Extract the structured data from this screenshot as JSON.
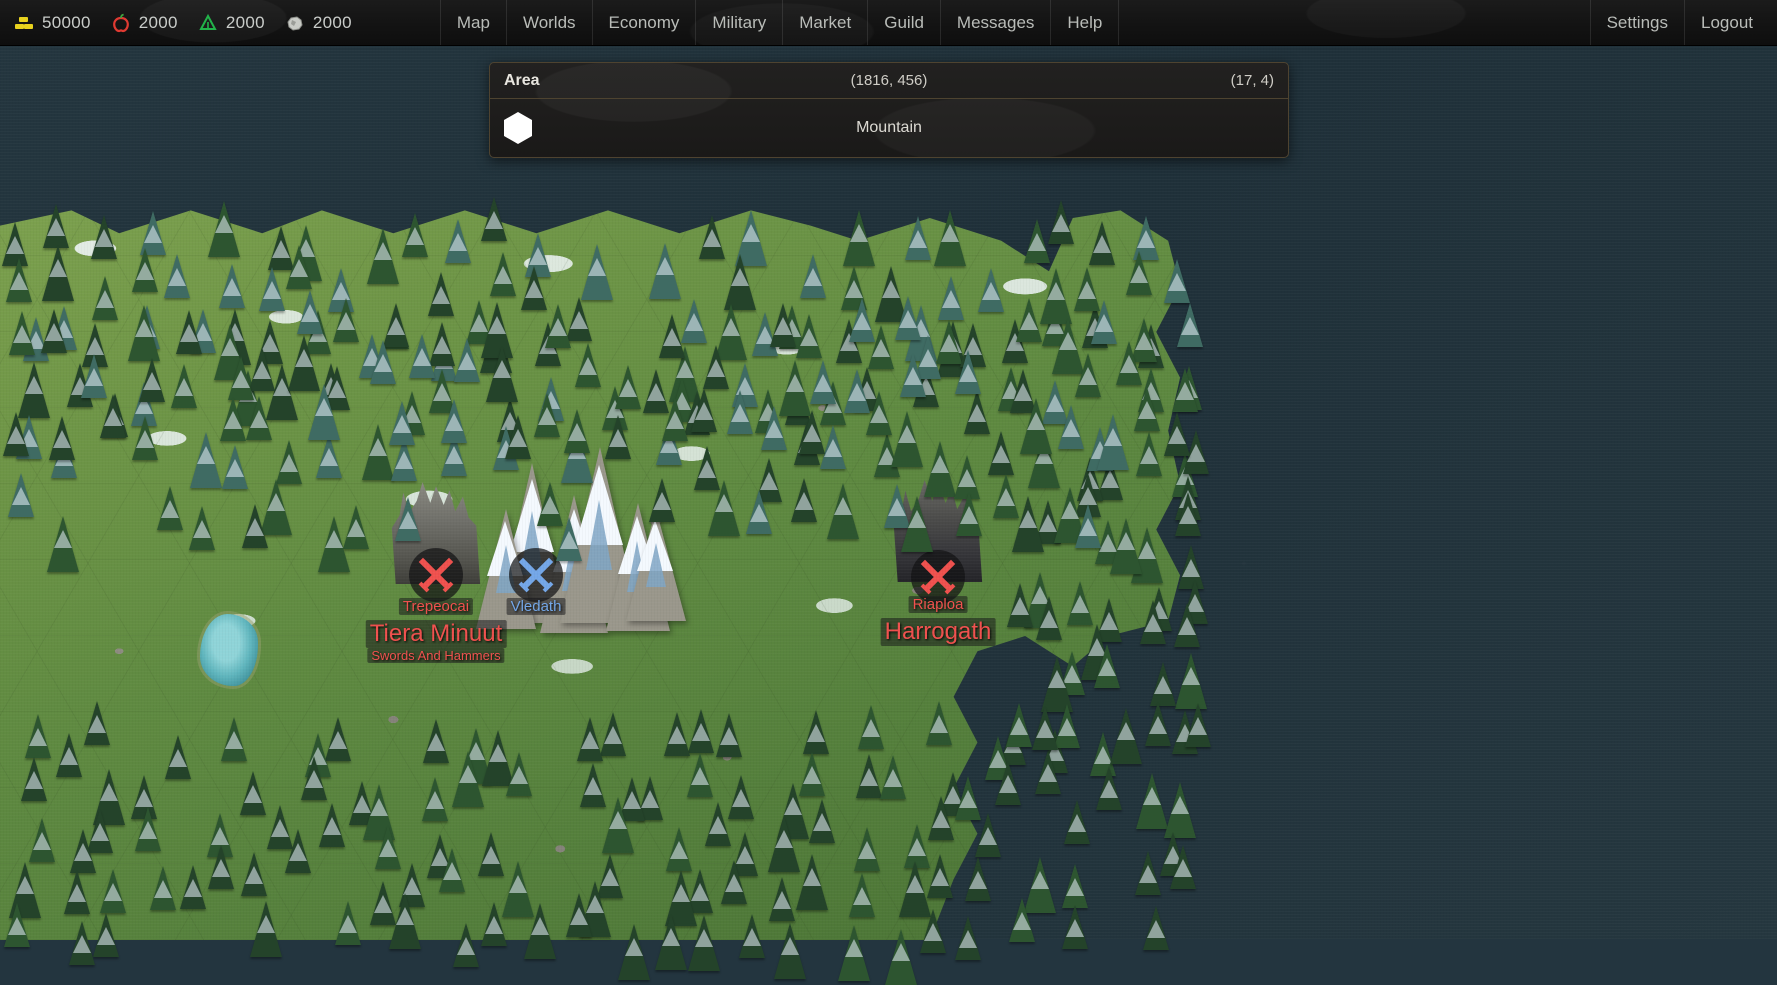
{
  "topbar": {
    "resources": [
      {
        "icon": "gold-bars-icon",
        "name": "gold",
        "value": "50000",
        "color": "#e8d21e"
      },
      {
        "icon": "apple-icon",
        "name": "food",
        "value": "2000",
        "color": "#e03a32"
      },
      {
        "icon": "tree-icon",
        "name": "wood",
        "value": "2000",
        "color": "#22b34a"
      },
      {
        "icon": "stone-icon",
        "name": "stone",
        "value": "2000",
        "color": "#b9bcb8"
      }
    ],
    "nav": [
      {
        "id": "map",
        "label": "Map"
      },
      {
        "id": "worlds",
        "label": "Worlds"
      },
      {
        "id": "economy",
        "label": "Economy"
      },
      {
        "id": "military",
        "label": "Military"
      },
      {
        "id": "market",
        "label": "Market"
      },
      {
        "id": "guild",
        "label": "Guild"
      },
      {
        "id": "messages",
        "label": "Messages"
      },
      {
        "id": "help",
        "label": "Help"
      }
    ],
    "account": [
      {
        "id": "settings",
        "label": "Settings"
      },
      {
        "id": "logout",
        "label": "Logout"
      }
    ]
  },
  "panel": {
    "title": "Area",
    "world_coords": "(1816, 456)",
    "hex_coords": "(17, 4)",
    "terrain_icon": "hexagon-icon",
    "terrain_name": "Mountain"
  },
  "map": {
    "settlements": [
      {
        "id": "trepeocai",
        "label": "Trepeocai",
        "owner_label": "Tiera Minuut",
        "guild_label": "Swords And Hammers",
        "marker": "crossed-swords-icon",
        "marker_color": "#f0514e",
        "faction": "red",
        "keep": "light"
      },
      {
        "id": "vledath",
        "label": "Vledath",
        "marker": "crossed-swords-icon",
        "marker_color": "#74a7e8",
        "faction": "blue",
        "keep": "none"
      },
      {
        "id": "riaploa",
        "label": "Riaploa",
        "owner_label": "Harrogath",
        "marker": "crossed-swords-icon",
        "marker_color": "#f0514e",
        "faction": "red",
        "keep": "dark"
      }
    ],
    "terrain_features": [
      {
        "id": "mountain-range",
        "name": "Mountain"
      },
      {
        "id": "lake",
        "name": "Lake"
      },
      {
        "id": "forest",
        "name": "Forest"
      }
    ],
    "water_color": "#24363f",
    "land_color": "#6f9647"
  }
}
